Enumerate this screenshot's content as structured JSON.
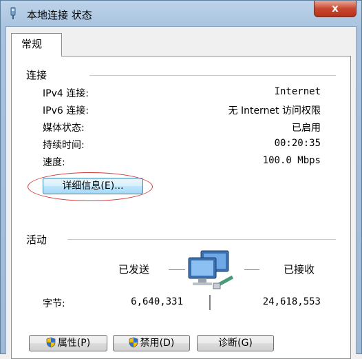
{
  "window": {
    "title": "本地连接 状态",
    "close_glyph": "x"
  },
  "tab": {
    "label": "常规"
  },
  "connection": {
    "heading": "连接",
    "rows": [
      {
        "label": "IPv4 连接:",
        "value": "Internet"
      },
      {
        "label": "IPv6 连接:",
        "value": "无 Internet 访问权限"
      },
      {
        "label": "媒体状态:",
        "value": "已启用"
      },
      {
        "label": "持续时间:",
        "value": "00:20:35"
      },
      {
        "label": "速度:",
        "value": "100.0 Mbps"
      }
    ],
    "details_button": "详细信息(E)..."
  },
  "activity": {
    "heading": "活动",
    "sent_label": "已发送",
    "received_label": "已接收",
    "bytes_label": "字节:",
    "bytes_sent": "6,640,331",
    "bytes_received": "24,618,553"
  },
  "buttons": {
    "properties": "属性(P)",
    "disable": "禁用(D)",
    "diagnose": "诊断(G)"
  },
  "colors": {
    "annotation": "#d33a3a",
    "accent": "#3c7fb1"
  }
}
